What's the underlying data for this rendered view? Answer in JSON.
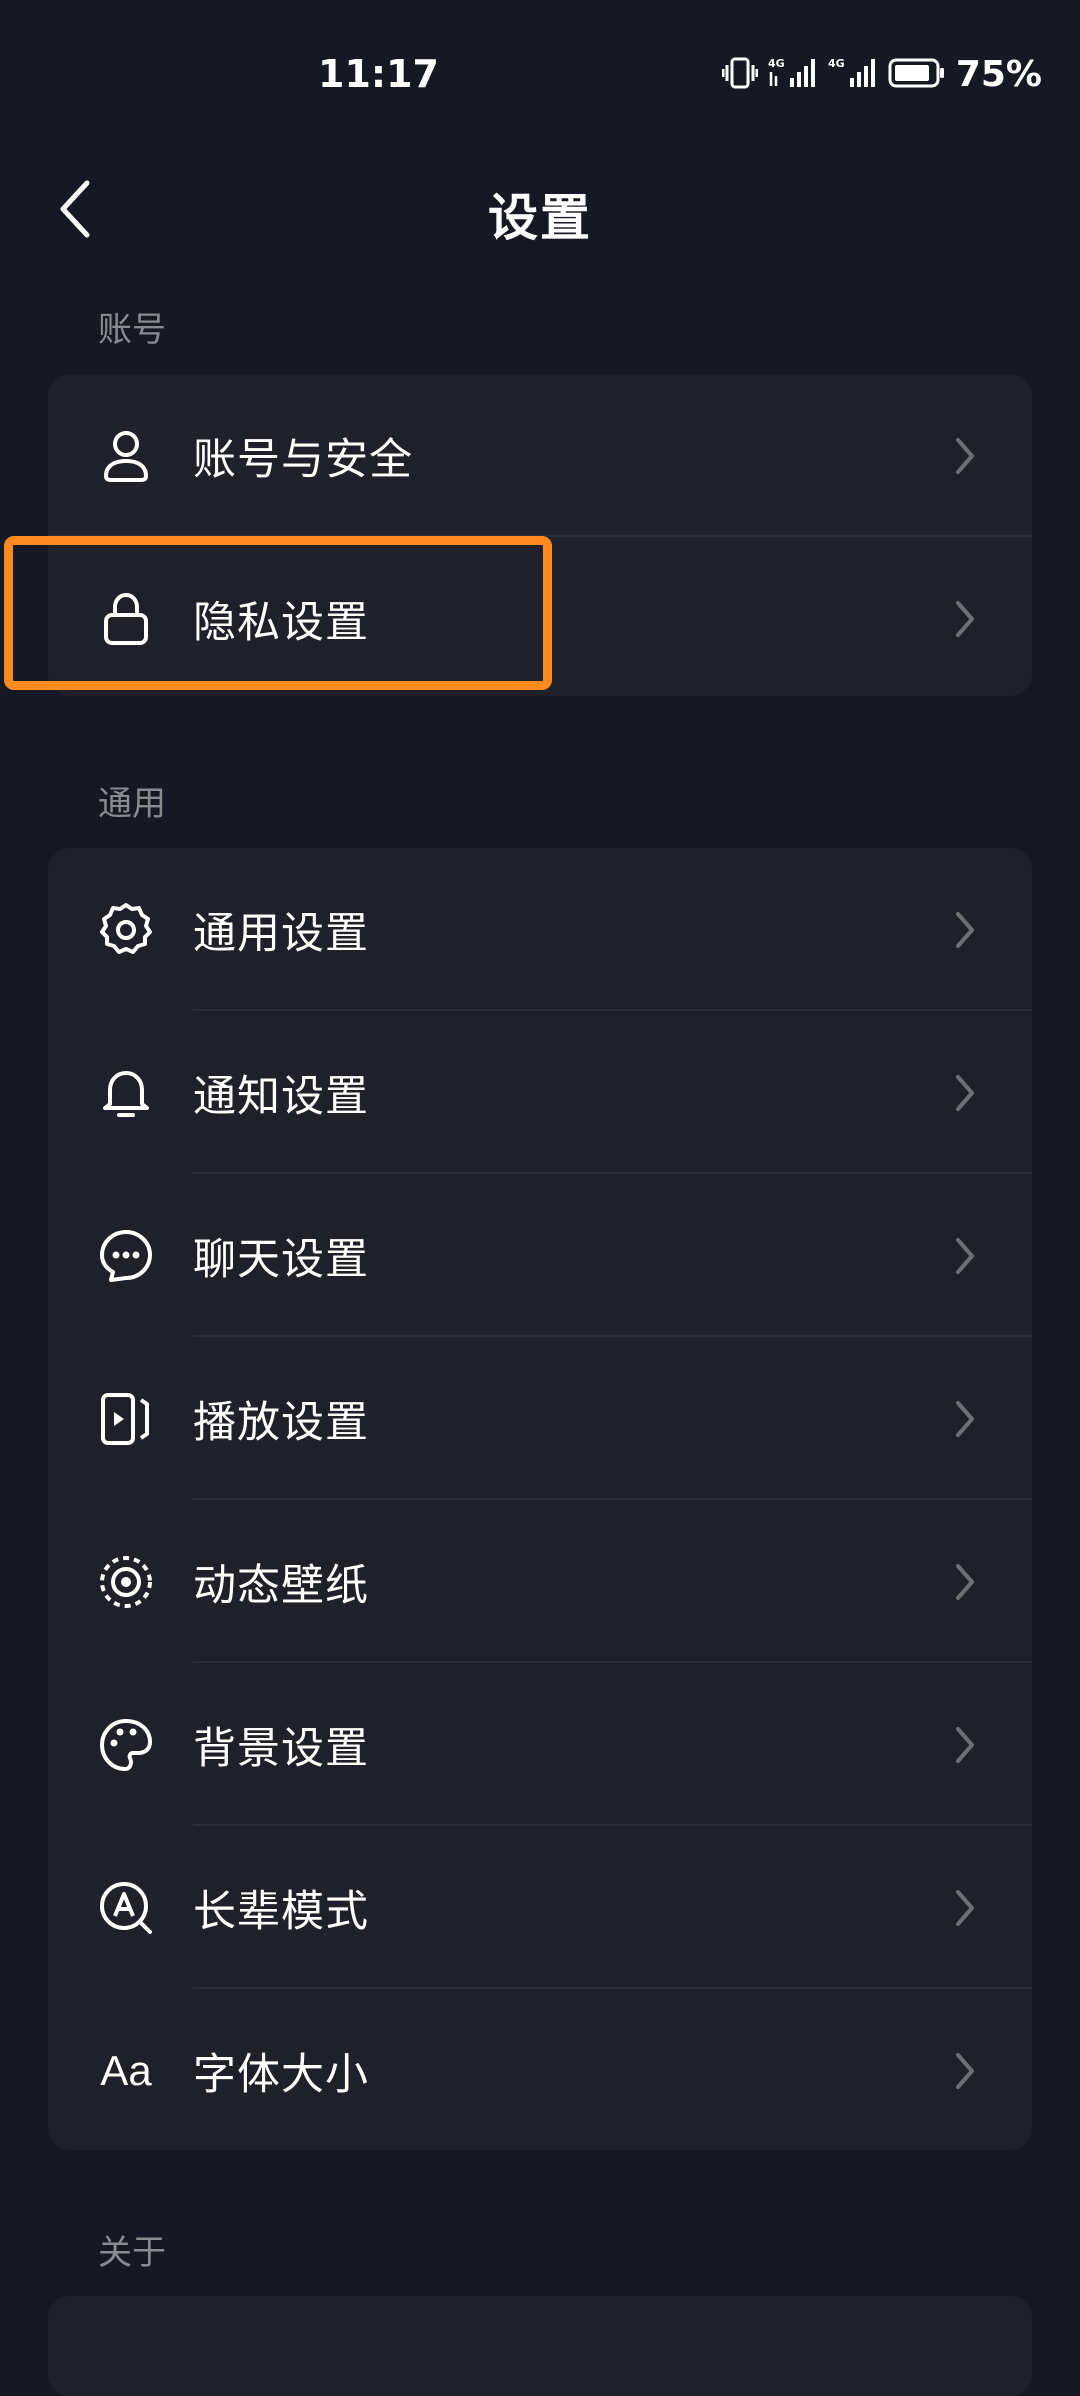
{
  "status_bar": {
    "time": "11:17",
    "battery_percent": "75%",
    "icons": [
      "vibrate-icon",
      "signal-4g-icon",
      "signal-4g-icon",
      "battery-icon"
    ]
  },
  "header": {
    "title": "设置",
    "back_icon": "chevron-left-icon"
  },
  "sections": {
    "account": {
      "title": "账号",
      "items": [
        {
          "label": "账号与安全",
          "icon": "user-icon"
        },
        {
          "label": "隐私设置",
          "icon": "lock-icon"
        }
      ]
    },
    "general": {
      "title": "通用",
      "items": [
        {
          "label": "通用设置",
          "icon": "gear-icon"
        },
        {
          "label": "通知设置",
          "icon": "bell-icon"
        },
        {
          "label": "聊天设置",
          "icon": "chat-bubble-icon"
        },
        {
          "label": "播放设置",
          "icon": "play-window-icon"
        },
        {
          "label": "动态壁纸",
          "icon": "live-wallpaper-icon"
        },
        {
          "label": "背景设置",
          "icon": "palette-icon"
        },
        {
          "label": "长辈模式",
          "icon": "elder-mode-icon"
        },
        {
          "label": "字体大小",
          "icon": "font-size-icon",
          "icon_text": "Aa"
        }
      ]
    },
    "about": {
      "title": "关于"
    }
  },
  "colors": {
    "background": "#161823",
    "card": "#1f2029",
    "highlight": "#ff8a1f",
    "section_title": "#8a8b91"
  }
}
